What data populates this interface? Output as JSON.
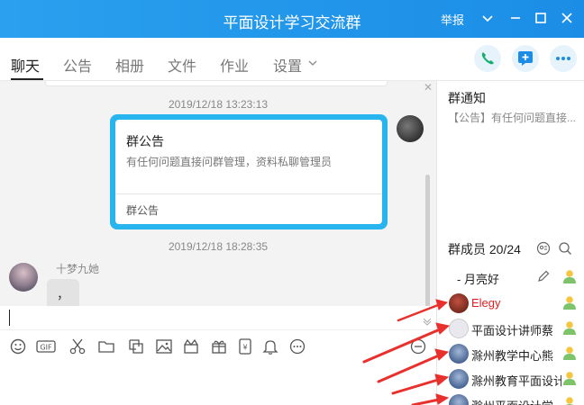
{
  "window": {
    "title": "平面设计学习交流群",
    "report_label": "举报"
  },
  "tabs": [
    {
      "label": "聊天",
      "active": true
    },
    {
      "label": "公告"
    },
    {
      "label": "相册"
    },
    {
      "label": "文件"
    },
    {
      "label": "作业"
    },
    {
      "label": "设置"
    }
  ],
  "header_buttons": [
    "phone-icon",
    "add-app-icon",
    "more-icon"
  ],
  "chat": {
    "messages": [
      {
        "type": "timestamp",
        "text": "2019/12/18 13:23:13"
      },
      {
        "type": "announcement",
        "title": "群公告",
        "description": "有任何问题直接问群管理，资料私聊管理员",
        "footer": "群公告"
      },
      {
        "type": "timestamp",
        "text": "2019/12/18 18:28:35"
      },
      {
        "type": "text",
        "sender": "十梦九她",
        "text": "，"
      }
    ]
  },
  "toolbar_icons": [
    "emoji-icon",
    "gif-icon",
    "scissors-icon",
    "folder-icon",
    "image-cut-icon",
    "picture-icon",
    "gift-box-icon",
    "gift-icon",
    "red-packet-icon",
    "bell-icon",
    "more-icon",
    "history-icon"
  ],
  "sidebar": {
    "notice_title": "群通知",
    "notice_text": "【公告】有任何问题直接...",
    "members_title": "群成员 20/24",
    "members": [
      {
        "name": "- 月亮好",
        "color": "#333333"
      },
      {
        "name": "Elegy",
        "color": "#e02020"
      },
      {
        "name": "平面设计讲师蔡",
        "color": "#333333"
      },
      {
        "name": "滁州教学中心熊",
        "color": "#333333"
      },
      {
        "name": "滁州教育平面设计",
        "color": "#333333"
      },
      {
        "name": "滁州平面设计学",
        "color": "#333333"
      }
    ]
  },
  "colors": {
    "title_bar": "#1b8de6",
    "announcement_border": "#27b4ef",
    "arrow": "#e8302c"
  }
}
